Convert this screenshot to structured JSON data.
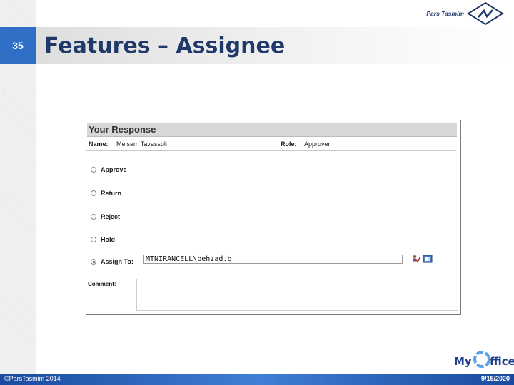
{
  "slide": {
    "number": "35",
    "title": "Features – Assignee",
    "brand_name": "Pars Tasmim",
    "footer_left": "©ParsTasmim 2014",
    "footer_date": "9/15/2020",
    "logo_left": "My",
    "logo_right": "ffice"
  },
  "form": {
    "header": "Your Response",
    "name_label": "Name:",
    "name_value": "Meisam Tavassoli",
    "role_label": "Role:",
    "role_value": "Approver",
    "options": [
      "Approve",
      "Return",
      "Reject",
      "Hold",
      "Assign To:"
    ],
    "selected_option": "Assign To:",
    "assign_value": "MTNIRANCELL\\behzad.b",
    "comment_label": "Comment:",
    "comment_value": ""
  },
  "icons": {
    "check_names": "check-names-icon",
    "address_book": "address-book-icon"
  },
  "colors": {
    "title": "#1f3a68",
    "slide_number_bg": "#2f6fc6",
    "footer": "#2a5fb8"
  }
}
